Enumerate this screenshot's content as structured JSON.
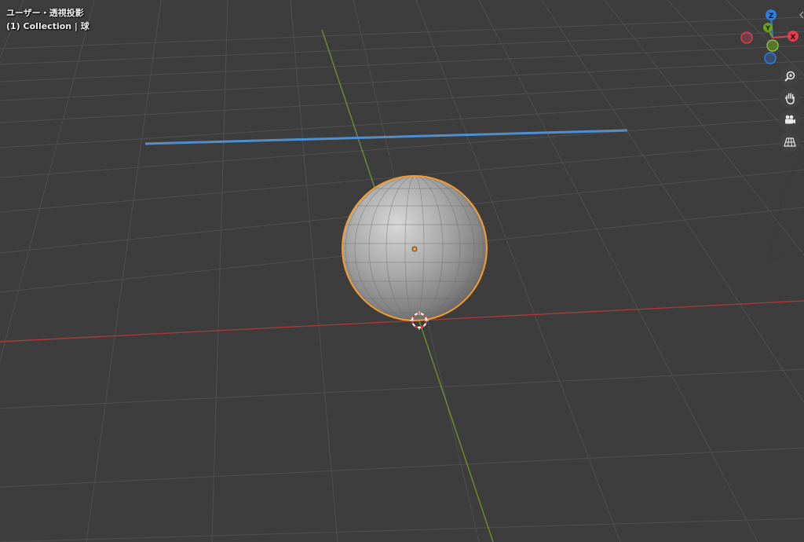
{
  "viewport": {
    "view_label": "ユーザー・透視投影",
    "collection_label": "(1) Collection | 球",
    "background_color": "#3d3d3d",
    "grid_color": "#4f4f4f",
    "x_axis_color": "#a63a3a",
    "y_axis_color": "#6e8f2c",
    "selection_outline_color": "#f59c2d",
    "camera_edge_color": "#4f8fd0"
  },
  "gizmo": {
    "axes": [
      {
        "label": "Z",
        "color": "#2f7fe0"
      },
      {
        "label": "Y",
        "color": "#6aa01a"
      },
      {
        "label": "X",
        "color": "#e0404e"
      }
    ]
  },
  "navigation": {
    "buttons": [
      {
        "name": "zoom",
        "icon": "zoom-icon"
      },
      {
        "name": "pan",
        "icon": "hand-icon"
      },
      {
        "name": "camera",
        "icon": "camera-icon"
      },
      {
        "name": "perspective",
        "icon": "grid-icon"
      }
    ]
  }
}
